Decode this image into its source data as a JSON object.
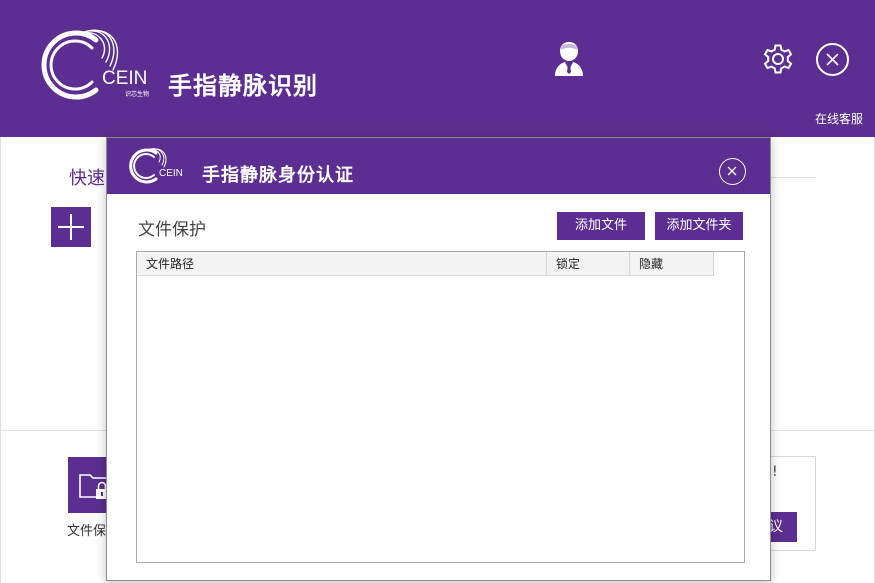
{
  "main": {
    "title": "手指静脉识别",
    "brand": "CEIN",
    "brand_sub": "识芯生物",
    "online_service": "在线客服",
    "quick_label": "快速",
    "file_tile_label": "文件保",
    "notice_mark": "!",
    "notice_button": "议",
    "icons": {
      "user": "user-icon",
      "settings": "gear-icon",
      "close": "close-icon",
      "add": "plus-icon",
      "folder_lock": "folder-lock-icon"
    }
  },
  "dialog": {
    "title": "手指静脉身份认证",
    "brand": "CEIN",
    "section_title": "文件保护",
    "add_file_button": "添加文件",
    "add_folder_button": "添加文件夹",
    "columns": [
      "文件路径",
      "锁定",
      "隐藏"
    ],
    "rows": []
  },
  "colors": {
    "brand_purple": "#5c2e91",
    "white": "#ffffff"
  }
}
